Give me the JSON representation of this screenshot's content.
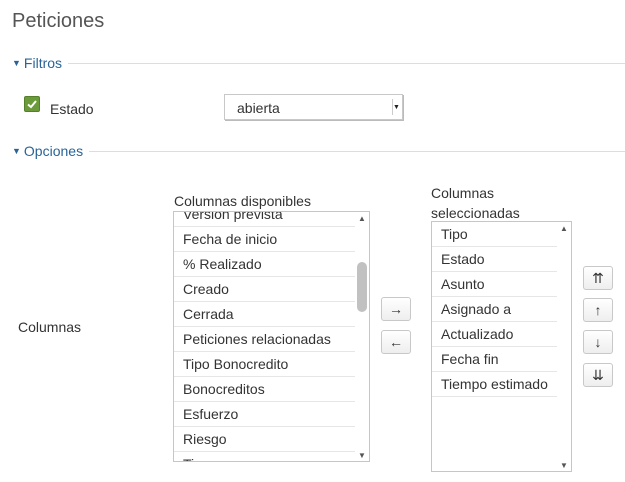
{
  "page": {
    "title": "Peticiones"
  },
  "filters": {
    "legend": "Filtros",
    "estado": {
      "label": "Estado",
      "checked": true,
      "value": "abierta"
    }
  },
  "options": {
    "legend": "Opciones",
    "columns_label": "Columnas",
    "available": {
      "label": "Columnas disponibles",
      "items": [
        "Versión prevista",
        "Fecha de inicio",
        "% Realizado",
        "Creado",
        "Cerrada",
        "Peticiones relacionadas",
        "Tipo Bonocredito",
        "Bonocreditos",
        "Esfuerzo",
        "Riesgo",
        "Tipo"
      ]
    },
    "selected": {
      "label_line1": "Columnas",
      "label_line2": "seleccionadas",
      "items": [
        "Tipo",
        "Estado",
        "Asunto",
        "Asignado a",
        "Actualizado",
        "Fecha fin",
        "Tiempo estimado"
      ]
    },
    "move_right": "→",
    "move_left": "←",
    "move_top": "⇈",
    "move_up": "↑",
    "move_down": "↓",
    "move_bottom": "⇊"
  }
}
